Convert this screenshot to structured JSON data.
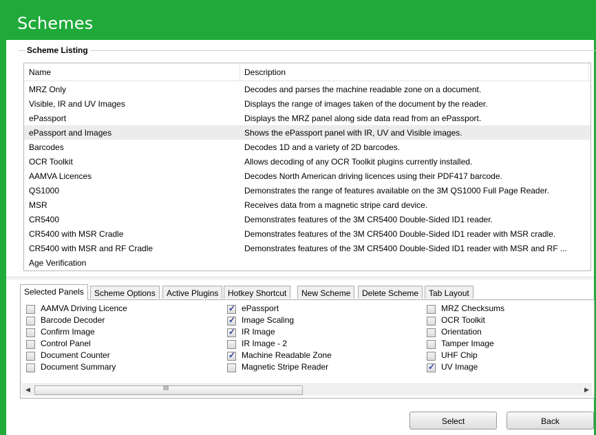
{
  "window": {
    "title": "Schemes"
  },
  "listing": {
    "group_label": "Scheme Listing",
    "columns": [
      "Name",
      "Description"
    ],
    "rows": [
      {
        "name": "MRZ Only",
        "desc": "Decodes and parses the machine readable zone on a document."
      },
      {
        "name": "Visible, IR and UV Images",
        "desc": "Displays the range of images taken of the document by the reader."
      },
      {
        "name": "ePassport",
        "desc": "Displays the MRZ panel along side data read from an ePassport."
      },
      {
        "name": "ePassport and Images",
        "desc": "Shows the ePassport panel with IR, UV and Visible images."
      },
      {
        "name": "Barcodes",
        "desc": "Decodes 1D and a variety of 2D barcodes."
      },
      {
        "name": "OCR Toolkit",
        "desc": "Allows decoding of any OCR Toolkit plugins currently installed."
      },
      {
        "name": "AAMVA Licences",
        "desc": "Decodes North American driving licences using their PDF417 barcode."
      },
      {
        "name": "QS1000",
        "desc": "Demonstrates the range of features available on the 3M QS1000 Full Page Reader."
      },
      {
        "name": "MSR",
        "desc": "Receives data from a magnetic stripe card device."
      },
      {
        "name": "CR5400",
        "desc": "Demonstrates features of the 3M CR5400 Double-Sided ID1 reader."
      },
      {
        "name": "CR5400 with MSR Cradle",
        "desc": "Demonstrates features of the 3M CR5400 Double-Sided ID1 reader with MSR cradle."
      },
      {
        "name": "CR5400 with MSR and RF Cradle",
        "desc": "Demonstrates features of the 3M CR5400 Double-Sided ID1 reader with MSR and RF ..."
      },
      {
        "name": "Age Verification",
        "desc": ""
      }
    ],
    "selected_index": 3
  },
  "tabs": [
    "Selected Panels",
    "Scheme Options",
    "Active Plugins",
    "Hotkey Shortcut",
    "New Scheme",
    "Delete Scheme",
    "Tab Layout"
  ],
  "active_tab": "Selected Panels",
  "panels": [
    {
      "label": "AAMVA Driving Licence",
      "checked": false
    },
    {
      "label": "Barcode Decoder",
      "checked": false
    },
    {
      "label": "Confirm Image",
      "checked": false
    },
    {
      "label": "Control Panel",
      "checked": false
    },
    {
      "label": "Document Counter",
      "checked": false
    },
    {
      "label": "Document Summary",
      "checked": false
    },
    {
      "label": "ePassport",
      "checked": true
    },
    {
      "label": "Image Scaling",
      "checked": true
    },
    {
      "label": "IR Image",
      "checked": true
    },
    {
      "label": "IR Image - 2",
      "checked": false
    },
    {
      "label": "Machine Readable Zone",
      "checked": true
    },
    {
      "label": "Magnetic Stripe Reader",
      "checked": false
    },
    {
      "label": "MRZ Checksums",
      "checked": false
    },
    {
      "label": "OCR Toolkit",
      "checked": false
    },
    {
      "label": "Orientation",
      "checked": false
    },
    {
      "label": "Tamper Image",
      "checked": false
    },
    {
      "label": "UHF Chip",
      "checked": false
    },
    {
      "label": "UV Image",
      "checked": true
    }
  ],
  "scrollbar": {
    "grip": "III"
  },
  "buttons": {
    "select": "Select",
    "back": "Back"
  },
  "colors": {
    "header": "#1faa3a",
    "selected_row": "#ececec",
    "check": "#2b3c9a"
  }
}
